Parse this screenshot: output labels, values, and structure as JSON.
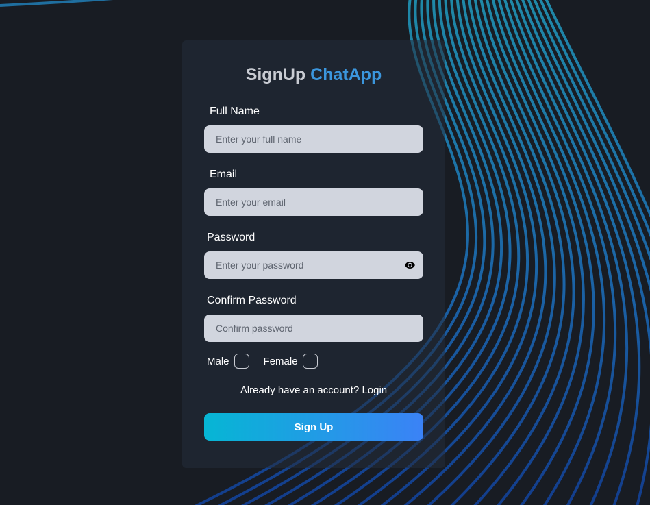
{
  "header": {
    "title_prefix": "SignUp",
    "title_accent": "ChatApp"
  },
  "form": {
    "full_name": {
      "label": "Full Name",
      "placeholder": "Enter your full name",
      "value": ""
    },
    "email": {
      "label": "Email",
      "placeholder": "Enter your email",
      "value": ""
    },
    "password": {
      "label": "Password",
      "placeholder": "Enter your password",
      "value": "",
      "toggle_icon": "eye-icon"
    },
    "confirm_password": {
      "label": "Confirm Password",
      "placeholder": "Confirm password",
      "value": ""
    },
    "gender": {
      "options": [
        {
          "label": "Male",
          "checked": false
        },
        {
          "label": "Female",
          "checked": false
        }
      ]
    },
    "login_link": "Already have an account? Login",
    "submit_label": "Sign Up"
  },
  "colors": {
    "background": "#181c23",
    "card": "#242e3c",
    "accent": "#3b96dd",
    "input_bg": "#d1d5de",
    "button_gradient_start": "#06b6d4",
    "button_gradient_end": "#3b82f6",
    "wave_lines": "#1e88c8"
  }
}
